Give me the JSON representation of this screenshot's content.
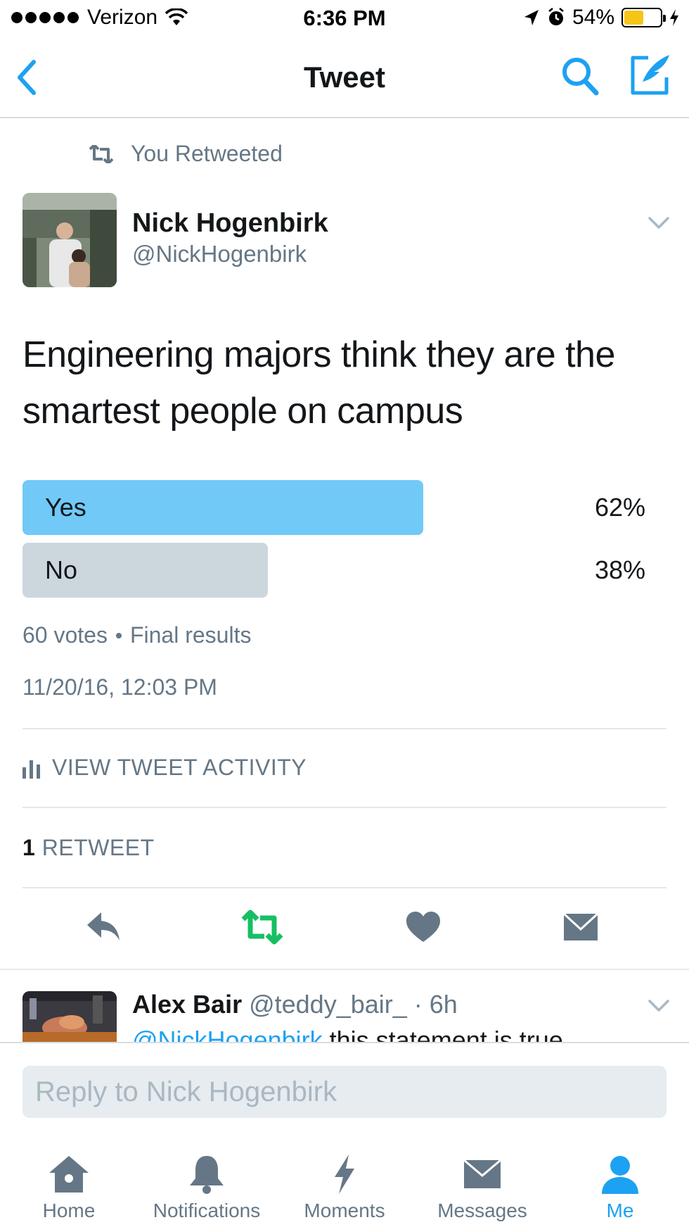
{
  "status_bar": {
    "carrier": "Verizon",
    "time": "6:36 PM",
    "battery": "54%",
    "battery_level": 0.54
  },
  "nav": {
    "title": "Tweet",
    "back_icon": "chevron-left-icon",
    "search_icon": "search-icon",
    "compose_icon": "compose-icon"
  },
  "retweet_context": {
    "label": "You Retweeted"
  },
  "tweet": {
    "author_name": "Nick Hogenbirk",
    "author_handle": "@NickHogenbirk",
    "text": "Engineering majors think they are the smartest people on campus",
    "poll": {
      "options": [
        {
          "label": "Yes",
          "percent": "62%",
          "fraction": 0.62,
          "color": "#71c9f8"
        },
        {
          "label": "No",
          "percent": "38%",
          "fraction": 0.38,
          "color": "#ccd6dd"
        }
      ],
      "votes": "60 votes",
      "status": "Final results"
    },
    "timestamp": "11/20/16, 12:03 PM",
    "activity_label": "VIEW TWEET ACTIVITY",
    "retweet_count": "1",
    "retweet_label": "RETWEET"
  },
  "reply_preview": {
    "name": "Alex Bair",
    "handle_time": "@teddy_bair_ · 6h",
    "mention": "@NickHogenbirk",
    "text": " this statement is true"
  },
  "composer": {
    "placeholder": "Reply to Nick Hogenbirk"
  },
  "tabs": [
    {
      "label": "Home",
      "icon": "home-icon"
    },
    {
      "label": "Notifications",
      "icon": "bell-icon"
    },
    {
      "label": "Moments",
      "icon": "lightning-icon"
    },
    {
      "label": "Messages",
      "icon": "envelope-icon"
    },
    {
      "label": "Me",
      "icon": "person-icon",
      "active": true
    }
  ],
  "colors": {
    "accent": "#1da1f2",
    "retweet_green": "#17bf63",
    "muted": "#657786",
    "icon_gray": "#657786"
  }
}
